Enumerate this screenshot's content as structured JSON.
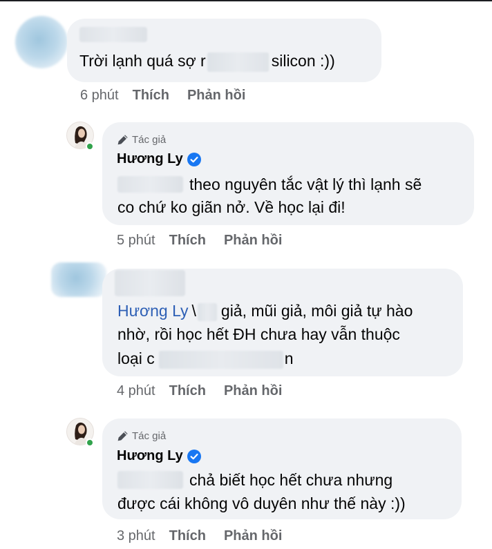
{
  "comments": [
    {
      "line1_before": "Trời lạnh quá sợ r",
      "line1_after": "silicon :))",
      "time": "6 phút",
      "like": "Thích",
      "reply": "Phản hồi"
    },
    {
      "badge": "Tác giả",
      "author": "Hương Ly",
      "line1": "theo nguyên tắc vật lý thì lạnh sẽ",
      "line2": "co chứ ko giãn nở. Về học lại đi!",
      "time": "5 phút",
      "like": "Thích",
      "reply": "Phản hồi"
    },
    {
      "mention": "Hương Ly",
      "line1_mid": "\\",
      "line1_rest": "giả, mũi giả, môi giả tự hào",
      "line2": "nhờ, rồi học hết ĐH chưa hay vẫn thuộc",
      "line3_start": "loại c",
      "line3_end": "n",
      "time": "4 phút",
      "like": "Thích",
      "reply": "Phản hồi"
    },
    {
      "badge": "Tác giả",
      "author": "Hương Ly",
      "line1": "chả biết học hết chưa nhưng",
      "line2": "được cái không vô duyên như thế này :))",
      "time": "3 phút",
      "like": "Thích",
      "reply": "Phản hồi"
    }
  ],
  "icons": {
    "badge": "pen-icon",
    "verified": "verified-badge-icon"
  },
  "colors": {
    "bubble": "#f0f2f5",
    "mention": "#2d5fb5",
    "verified": "#1877f2",
    "online": "#31a24c",
    "meta": "#65676b"
  }
}
